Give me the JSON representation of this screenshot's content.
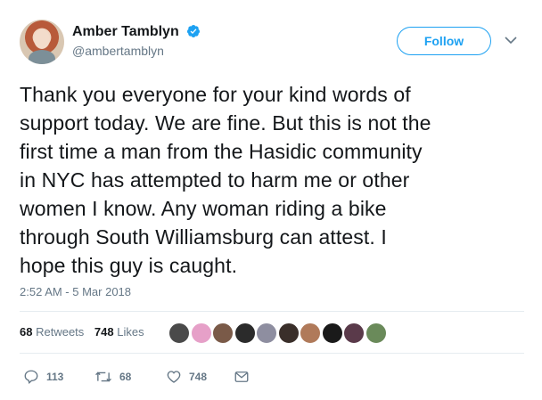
{
  "user": {
    "display_name": "Amber Tamblyn",
    "handle": "@ambertamblyn"
  },
  "follow_label": "Follow",
  "tweet": {
    "lines": [
      "Thank you everyone for your kind words of",
      "support today. We are fine. But this is not the",
      "first time a man from the Hasidic community",
      "in NYC has attempted to harm me or other",
      "women I know. Any woman riding a bike",
      "through South Williamsburg can attest. I",
      "hope this guy is caught."
    ],
    "timestamp": "2:52 AM - 5 Mar 2018"
  },
  "stats": {
    "retweets_count": "68",
    "retweets_label": "Retweets",
    "likes_count": "748",
    "likes_label": "Likes"
  },
  "likers": [
    {
      "name": "liker-1",
      "color": "#4a4a4a"
    },
    {
      "name": "liker-2",
      "color": "#e6a0c8"
    },
    {
      "name": "liker-3",
      "color": "#7a5a48"
    },
    {
      "name": "liker-4",
      "color": "#2b2b2b"
    },
    {
      "name": "liker-5",
      "color": "#8e8ea0"
    },
    {
      "name": "liker-6",
      "color": "#3a2f2a"
    },
    {
      "name": "liker-7",
      "color": "#b07a5a"
    },
    {
      "name": "liker-8",
      "color": "#1a1a1a"
    },
    {
      "name": "liker-9",
      "color": "#5a3a4a"
    },
    {
      "name": "liker-10",
      "color": "#6a8a5a"
    }
  ],
  "actions": {
    "reply_count": "113",
    "retweet_count": "68",
    "like_count": "748"
  },
  "colors": {
    "accent": "#1da1f2",
    "secondary_text": "#657786"
  }
}
